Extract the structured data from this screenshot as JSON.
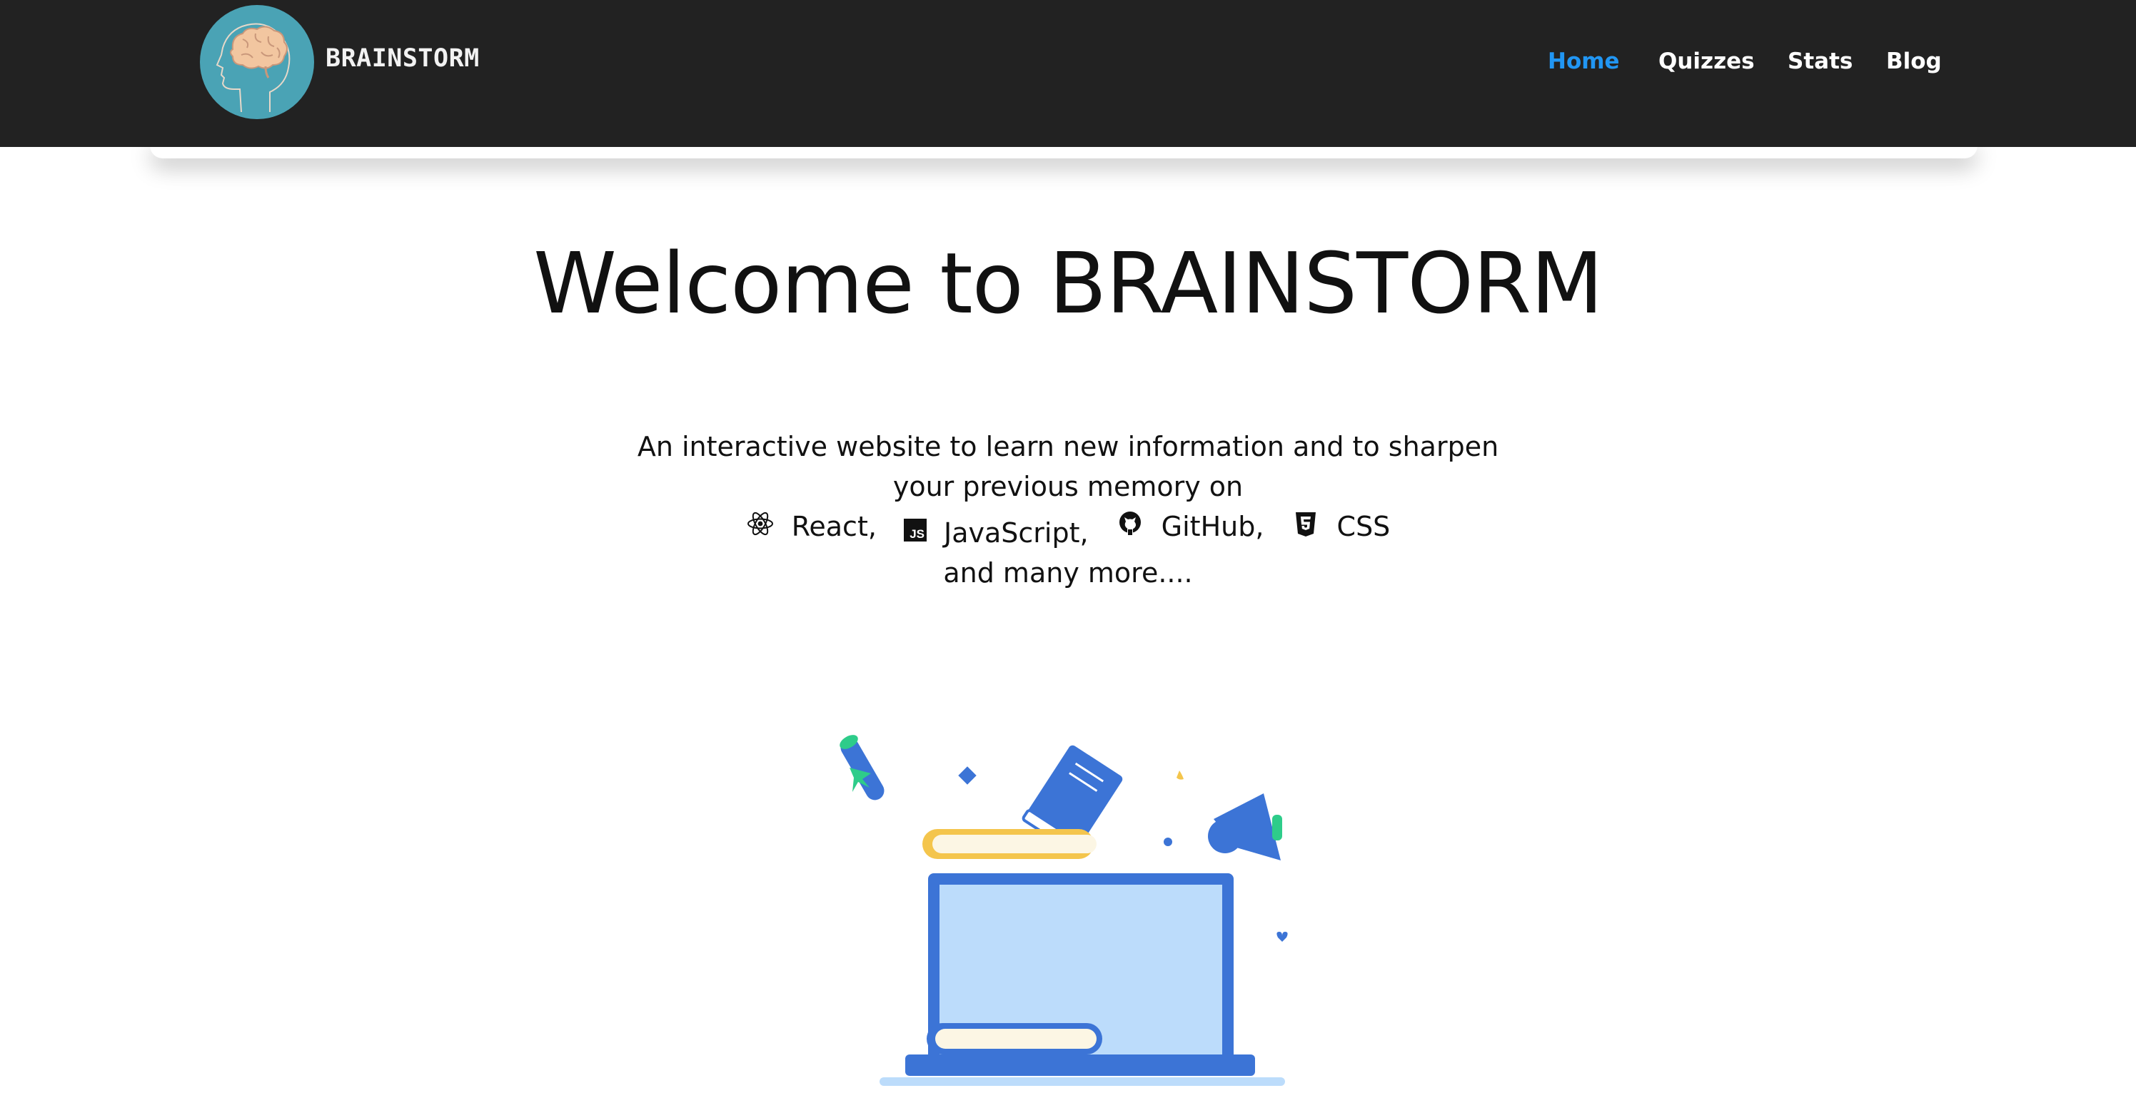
{
  "brand": {
    "name": "BRAINSTORM",
    "logo_icon": "brain-head-icon"
  },
  "nav": {
    "items": [
      {
        "label": "Home",
        "active": true
      },
      {
        "label": "Quizzes",
        "active": false
      },
      {
        "label": "Stats",
        "active": false
      },
      {
        "label": "Blog",
        "active": false
      }
    ]
  },
  "hero": {
    "title": "Welcome to BRAINSTORM",
    "description_line1": "An interactive website to learn new information and to sharpen",
    "description_line2": "your previous memory on",
    "techs": [
      {
        "label": "React,",
        "icon": "react-icon"
      },
      {
        "label": "JavaScript,",
        "icon": "javascript-icon"
      },
      {
        "label": "GitHub,",
        "icon": "github-icon"
      },
      {
        "label": "CSS",
        "icon": "css3-icon"
      }
    ],
    "description_line4": "and many more...."
  },
  "colors": {
    "navbar_bg": "#222222",
    "active_link": "#2196f3",
    "logo_bg": "#4aa3b5",
    "illustration_blue": "#3c74d6",
    "illustration_light_blue": "#bcdcfb",
    "illustration_yellow": "#f4c54c",
    "illustration_green": "#2ecc8a"
  }
}
